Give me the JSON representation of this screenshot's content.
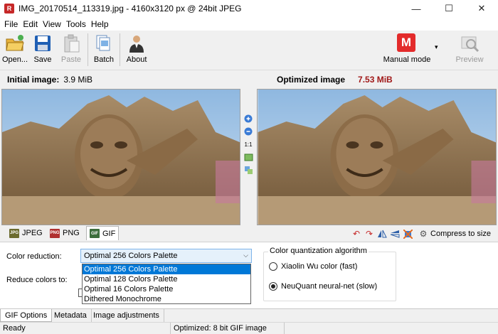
{
  "window": {
    "title": "IMG_20170514_113319.jpg - 4160x3120 px @ 24bit JPEG",
    "app_icon_letter": "R",
    "minimize": "—",
    "maximize": "☐",
    "close": "✕"
  },
  "menu": [
    "File",
    "Edit",
    "View",
    "Tools",
    "Help"
  ],
  "toolbar": {
    "open": "Open...",
    "save": "Save",
    "paste": "Paste",
    "batch": "Batch",
    "about": "About",
    "mode_icon_letter": "M",
    "mode": "Manual mode",
    "mode_arrow": "▾",
    "preview": "Preview"
  },
  "initial": {
    "label": "Initial image:",
    "size": "3.9 MiB"
  },
  "optimized": {
    "label": "Optimized image",
    "size": "7.53 MiB",
    "size_color": "#a01818"
  },
  "zoom_ratio": "1:1",
  "format_tabs": [
    {
      "label": "JPEG",
      "icon": "JPG",
      "color": "#6b6b2e"
    },
    {
      "label": "PNG",
      "icon": "PNG",
      "color": "#b03030"
    },
    {
      "label": "GIF",
      "icon": "GIF",
      "color": "#3c6e3c"
    }
  ],
  "compress_to_size": "Compress to size",
  "options": {
    "color_reduction_label": "Color reduction:",
    "color_reduction_value": "Optimal 256 Colors Palette",
    "reduce_colors_label": "Reduce colors to:",
    "dropdown": [
      "Optimal 256 Colors Palette",
      "Optimal 128 Colors Palette",
      "Optimal 16 Colors Palette",
      "Dithered Monochrome"
    ],
    "algorithm_title": "Color quantization algorithm",
    "algo_xiaolin": "Xiaolin Wu color (fast)",
    "algo_neuquant": "NeuQuant neural-net (slow)",
    "selected_algorithm": "neuquant"
  },
  "bottom_tabs": [
    "GIF Options",
    "Metadata",
    "Image adjustments"
  ],
  "status": {
    "left": "Ready",
    "middle": "Optimized: 8 bit GIF image"
  }
}
